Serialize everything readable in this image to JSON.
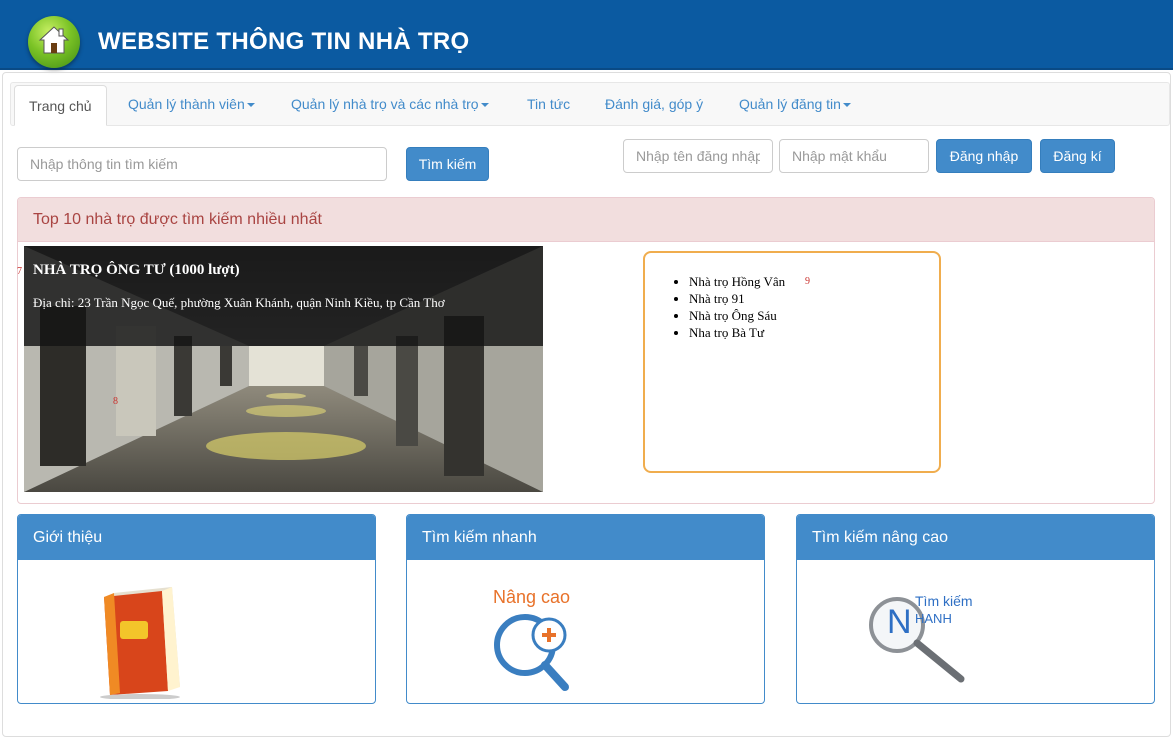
{
  "header": {
    "title": "WEBSITE THÔNG TIN NHÀ TRỌ",
    "logo_icon": "home-icon"
  },
  "nav": {
    "home": "Trang chủ",
    "members": "Quản lý thành viên",
    "rooms": "Quản lý nhà trọ và các nhà trọ",
    "news": "Tin tức",
    "feedback": "Đánh giá, góp ý",
    "posts": "Quản lý đăng tin"
  },
  "search": {
    "placeholder": "Nhập thông tin tìm kiếm",
    "button": "Tìm kiếm"
  },
  "login": {
    "username_placeholder": "Nhập tên đăng nhập",
    "password_placeholder": "Nhập mật khẩu",
    "login_button": "Đăng nhập",
    "register_button": "Đăng kí"
  },
  "top_panel": {
    "heading": "Top 10 nhà trọ được tìm kiếm nhiều nhất",
    "slide": {
      "title": "NHÀ TRỌ ÔNG TƯ (1000 lượt)",
      "address": "Địa chỉ: 23 Trần Ngọc Quế, phường Xuân Khánh, quận Ninh Kiều, tp Cần Thơ"
    },
    "markers": {
      "prev": "7",
      "slide": "8",
      "list": "9"
    },
    "list": [
      "Nhà trọ Hồng Vân",
      "Nhà trọ 91",
      "Nhà trọ Ông Sáu",
      "Nha trọ Bà Tư"
    ]
  },
  "cards": {
    "intro": {
      "title": "Giới thiệu"
    },
    "quick": {
      "title": "Tìm kiếm nhanh",
      "image_text": "Nâng cao"
    },
    "advanced": {
      "title": "Tìm kiếm nâng cao",
      "image_text_1": "Tìm kiếm",
      "image_text_2": "HANH",
      "image_letter": "N"
    }
  },
  "colors": {
    "header": "#0b5aa1",
    "primary": "#428bca",
    "danger_bg": "#f2dede",
    "danger_text": "#a94442",
    "warning_border": "#f0ad4e"
  }
}
